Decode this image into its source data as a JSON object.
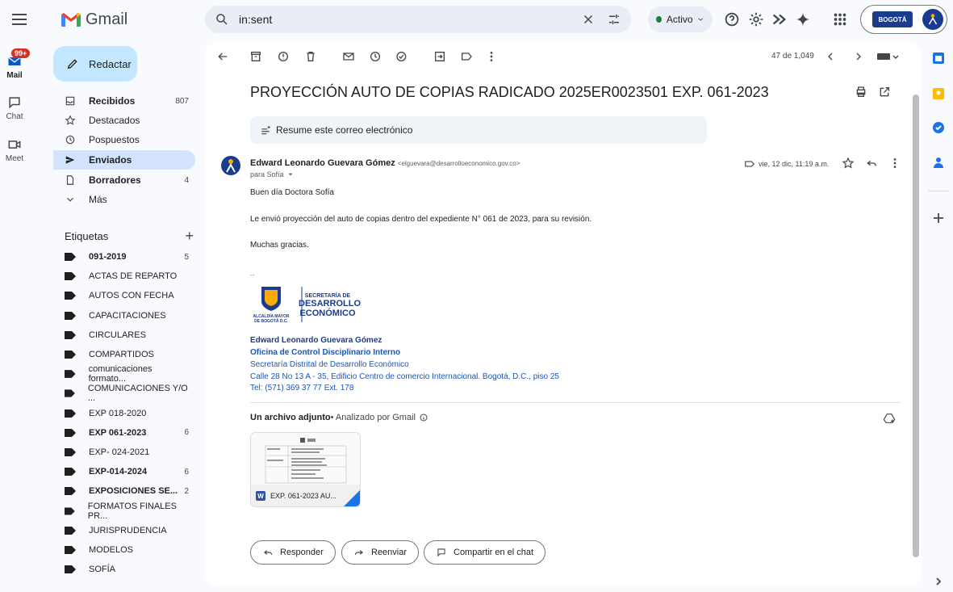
{
  "app": {
    "name": "Gmail"
  },
  "search": {
    "value": "in:sent"
  },
  "status": {
    "label": "Activo"
  },
  "org_badge": {
    "logo_text": "BOGOTÁ"
  },
  "rail": {
    "mail_label": "Mail",
    "mail_badge": "99+",
    "chat_label": "Chat",
    "meet_label": "Meet"
  },
  "compose": {
    "label": "Redactar"
  },
  "nav": [
    {
      "label": "Recibidos",
      "count": "807",
      "icon": "inbox-icon",
      "bold": true
    },
    {
      "label": "Destacados",
      "count": "",
      "icon": "star-icon",
      "bold": false
    },
    {
      "label": "Pospuestos",
      "count": "",
      "icon": "clock-icon",
      "bold": false
    },
    {
      "label": "Enviados",
      "count": "",
      "icon": "send-icon",
      "bold": true
    },
    {
      "label": "Borradores",
      "count": "4",
      "icon": "draft-icon",
      "bold": true
    },
    {
      "label": "Más",
      "count": "",
      "icon": "chevron-down-icon",
      "bold": false
    }
  ],
  "labels": {
    "heading": "Etiquetas",
    "items": [
      {
        "label": "091-2019",
        "count": "5",
        "bold": true
      },
      {
        "label": "ACTAS DE REPARTO",
        "count": "",
        "bold": false
      },
      {
        "label": "AUTOS CON FECHA",
        "count": "",
        "bold": false
      },
      {
        "label": "CAPACITACIONES",
        "count": "",
        "bold": false
      },
      {
        "label": "CIRCULARES",
        "count": "",
        "bold": false
      },
      {
        "label": "COMPARTIDOS",
        "count": "",
        "bold": false
      },
      {
        "label": "comunicaciones formato...",
        "count": "",
        "bold": false
      },
      {
        "label": "COMUNICACIONES Y/O ...",
        "count": "",
        "bold": false
      },
      {
        "label": "EXP 018-2020",
        "count": "",
        "bold": false
      },
      {
        "label": "EXP 061-2023",
        "count": "6",
        "bold": true
      },
      {
        "label": "EXP- 024-2021",
        "count": "",
        "bold": false
      },
      {
        "label": "EXP-014-2024",
        "count": "6",
        "bold": true
      },
      {
        "label": "EXPOSICIONES SE...",
        "count": "2",
        "bold": true
      },
      {
        "label": "FORMATOS FINALES PR...",
        "count": "",
        "bold": false
      },
      {
        "label": "JURISPRUDENCIA",
        "count": "",
        "bold": false
      },
      {
        "label": "MODELOS",
        "count": "",
        "bold": false
      },
      {
        "label": "SOFÍA",
        "count": "",
        "bold": false
      }
    ]
  },
  "pager": {
    "text": "47 de 1,049"
  },
  "email": {
    "subject": "PROYECCIÓN AUTO DE COPIAS RADICADO 2025ER0023501 EXP. 061-2023",
    "summarize_label": "Resume este correo electrónico",
    "sender_name": "Edward Leonardo Guevara Gómez",
    "sender_email": "<elguevara@desarrolloeconomico.gov.co>",
    "to": "para Sofía",
    "date": "vie, 12 dic, 11:19 a.m.",
    "greeting": "Buen día Doctora Sofía",
    "body": "Le envió proyección del auto de copias dentro del expediente N° 061 de 2023, para su revisión.",
    "thanks": "Muchas gracias.",
    "separator": "--",
    "signature_logo": {
      "left": "ALCALDÍA MAYOR DE BOGOTÁ D.C.",
      "line1": "SECRETARÍA DE",
      "line2": "DESARROLLO",
      "line3": "ECONÓMICO"
    },
    "sig_name": "Edward Leonardo Guevara Gómez",
    "sig_office": "Oficina de Control Disciplinario Interno",
    "sig_org": "Secretaría Distrital de Desarrollo Económico",
    "sig_address": "Calle 28 No 13 A - 35, Edificio Centro de comercio Internacional. Bogotá, D.C., piso 25",
    "sig_tel": "Tel: (571) 369 37 77 Ext. 178"
  },
  "attachment": {
    "heading": "Un archivo adjunto",
    "scan_note": " • Analizado por Gmail",
    "filename": "EXP. 061-2023 AU...",
    "type_letter": "W"
  },
  "actions": {
    "reply": "Responder",
    "forward": "Reenviar",
    "share": "Compartir en el chat"
  },
  "colors": {
    "compose_bg": "#c2e7ff",
    "active_nav_bg": "#d3e3fd",
    "status_green": "#188038",
    "link_blue": "#1a56b8"
  }
}
